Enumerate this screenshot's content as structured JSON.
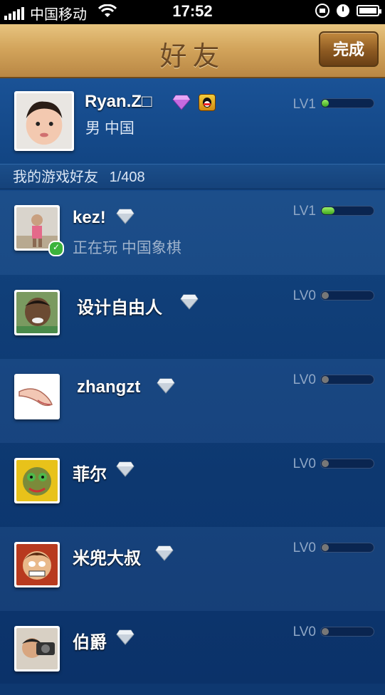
{
  "status_bar": {
    "carrier": "中国移动",
    "time": "17:52"
  },
  "nav": {
    "title": "好友",
    "done_label": "完成"
  },
  "me": {
    "name": "Ryan.Z□",
    "info": "男 中国",
    "level": "LV1",
    "progress": 0.1
  },
  "section": {
    "title": "我的游戏好友",
    "count": "1/408"
  },
  "friends": [
    {
      "name": "kez!",
      "status": "正在玩 中国象棋",
      "level": "LV1",
      "progress": 0.25,
      "online": true
    },
    {
      "name": "设计自由人",
      "status": "",
      "level": "LV0",
      "progress": 0
    },
    {
      "name": "zhangzt",
      "status": "",
      "level": "LV0",
      "progress": 0
    },
    {
      "name": "菲尔",
      "status": "",
      "level": "LV0",
      "progress": 0
    },
    {
      "name": "米兜大叔",
      "status": "",
      "level": "LV0",
      "progress": 0
    },
    {
      "name": "伯爵",
      "status": "",
      "level": "LV0",
      "progress": 0
    }
  ],
  "colors": {
    "nav_wood": "#d3a55c",
    "list_bg": "#0f3c78",
    "progress_green": "#5ccf2e"
  }
}
